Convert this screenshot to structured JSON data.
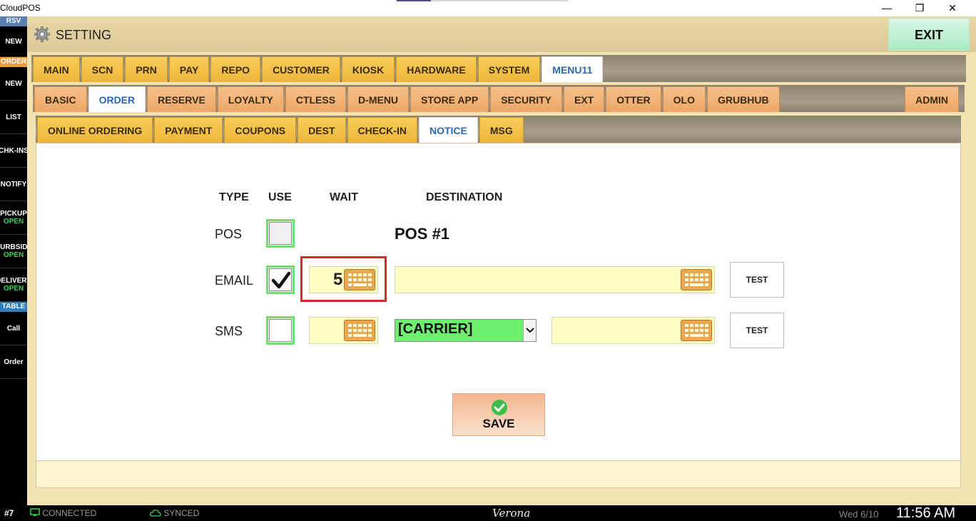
{
  "window": {
    "title": "CloudPOS",
    "minimize": "—",
    "restore": "❐",
    "close": "✕"
  },
  "sidebar": {
    "sections": [
      {
        "head": "RSV",
        "head_color": "#5a7fb0",
        "items": [
          {
            "label": "NEW",
            "sub": ""
          }
        ]
      },
      {
        "head": "ORDER",
        "head_color": "#e8a040",
        "items": [
          {
            "label": "NEW",
            "sub": ""
          },
          {
            "label": "LIST",
            "sub": ""
          },
          {
            "label": "CHK-INS",
            "sub": ""
          },
          {
            "label": "NOTIFY",
            "sub": ""
          },
          {
            "label": "PICKUP",
            "sub": "OPEN"
          },
          {
            "label": "CURBSIDE",
            "sub": "OPEN"
          },
          {
            "label": "DELIVERY",
            "sub": "OPEN"
          }
        ]
      },
      {
        "head": "TABLE",
        "head_color": "#2a7fb8",
        "items": [
          {
            "label": "Call",
            "sub": ""
          },
          {
            "label": "Order",
            "sub": ""
          }
        ]
      }
    ]
  },
  "header": {
    "title": "SETTING",
    "exit": "EXIT"
  },
  "tabs_row1": [
    "MAIN",
    "SCN",
    "PRN",
    "PAY",
    "REPO",
    "CUSTOMER",
    "KIOSK",
    "HARDWARE",
    "SYSTEM",
    "MENU11"
  ],
  "tabs_row1_active": "MENU11",
  "tabs_row2": [
    "BASIC",
    "ORDER",
    "RESERVE",
    "LOYALTY",
    "CTLESS",
    "D-MENU",
    "STORE APP",
    "SECURITY",
    "EXT",
    "OTTER",
    "OLO",
    "GRUBHUB"
  ],
  "tabs_row2_active": "ORDER",
  "tabs_row2_admin": "ADMIN",
  "tabs_row3": [
    "ONLINE ORDERING",
    "PAYMENT",
    "COUPONS",
    "DEST",
    "CHECK-IN",
    "NOTICE",
    "MSG"
  ],
  "tabs_row3_active": "NOTICE",
  "notice": {
    "headers": {
      "type": "TYPE",
      "use": "USE",
      "wait": "WAIT",
      "destination": "DESTINATION"
    },
    "rows": [
      {
        "type": "POS",
        "use": false,
        "wait": "",
        "destination": "POS #1"
      },
      {
        "type": "EMAIL",
        "use": true,
        "wait": "5",
        "destination": "",
        "test": "TEST"
      },
      {
        "type": "SMS",
        "use": false,
        "wait": "",
        "carrier": "[CARRIER]",
        "destination": "",
        "test": "TEST"
      }
    ],
    "save": "SAVE"
  },
  "statusbar": {
    "station": "#7",
    "connected": "CONNECTED",
    "synced": "SYNCED",
    "store": "Verona",
    "date": "Wed 6/10",
    "time": "11:56 AM"
  },
  "colors": {
    "highlight": "#d42a2a",
    "checkbox_border": "#6ee06e",
    "input_bg": "#ffffc4",
    "carrier_bg": "#6ef06e"
  }
}
